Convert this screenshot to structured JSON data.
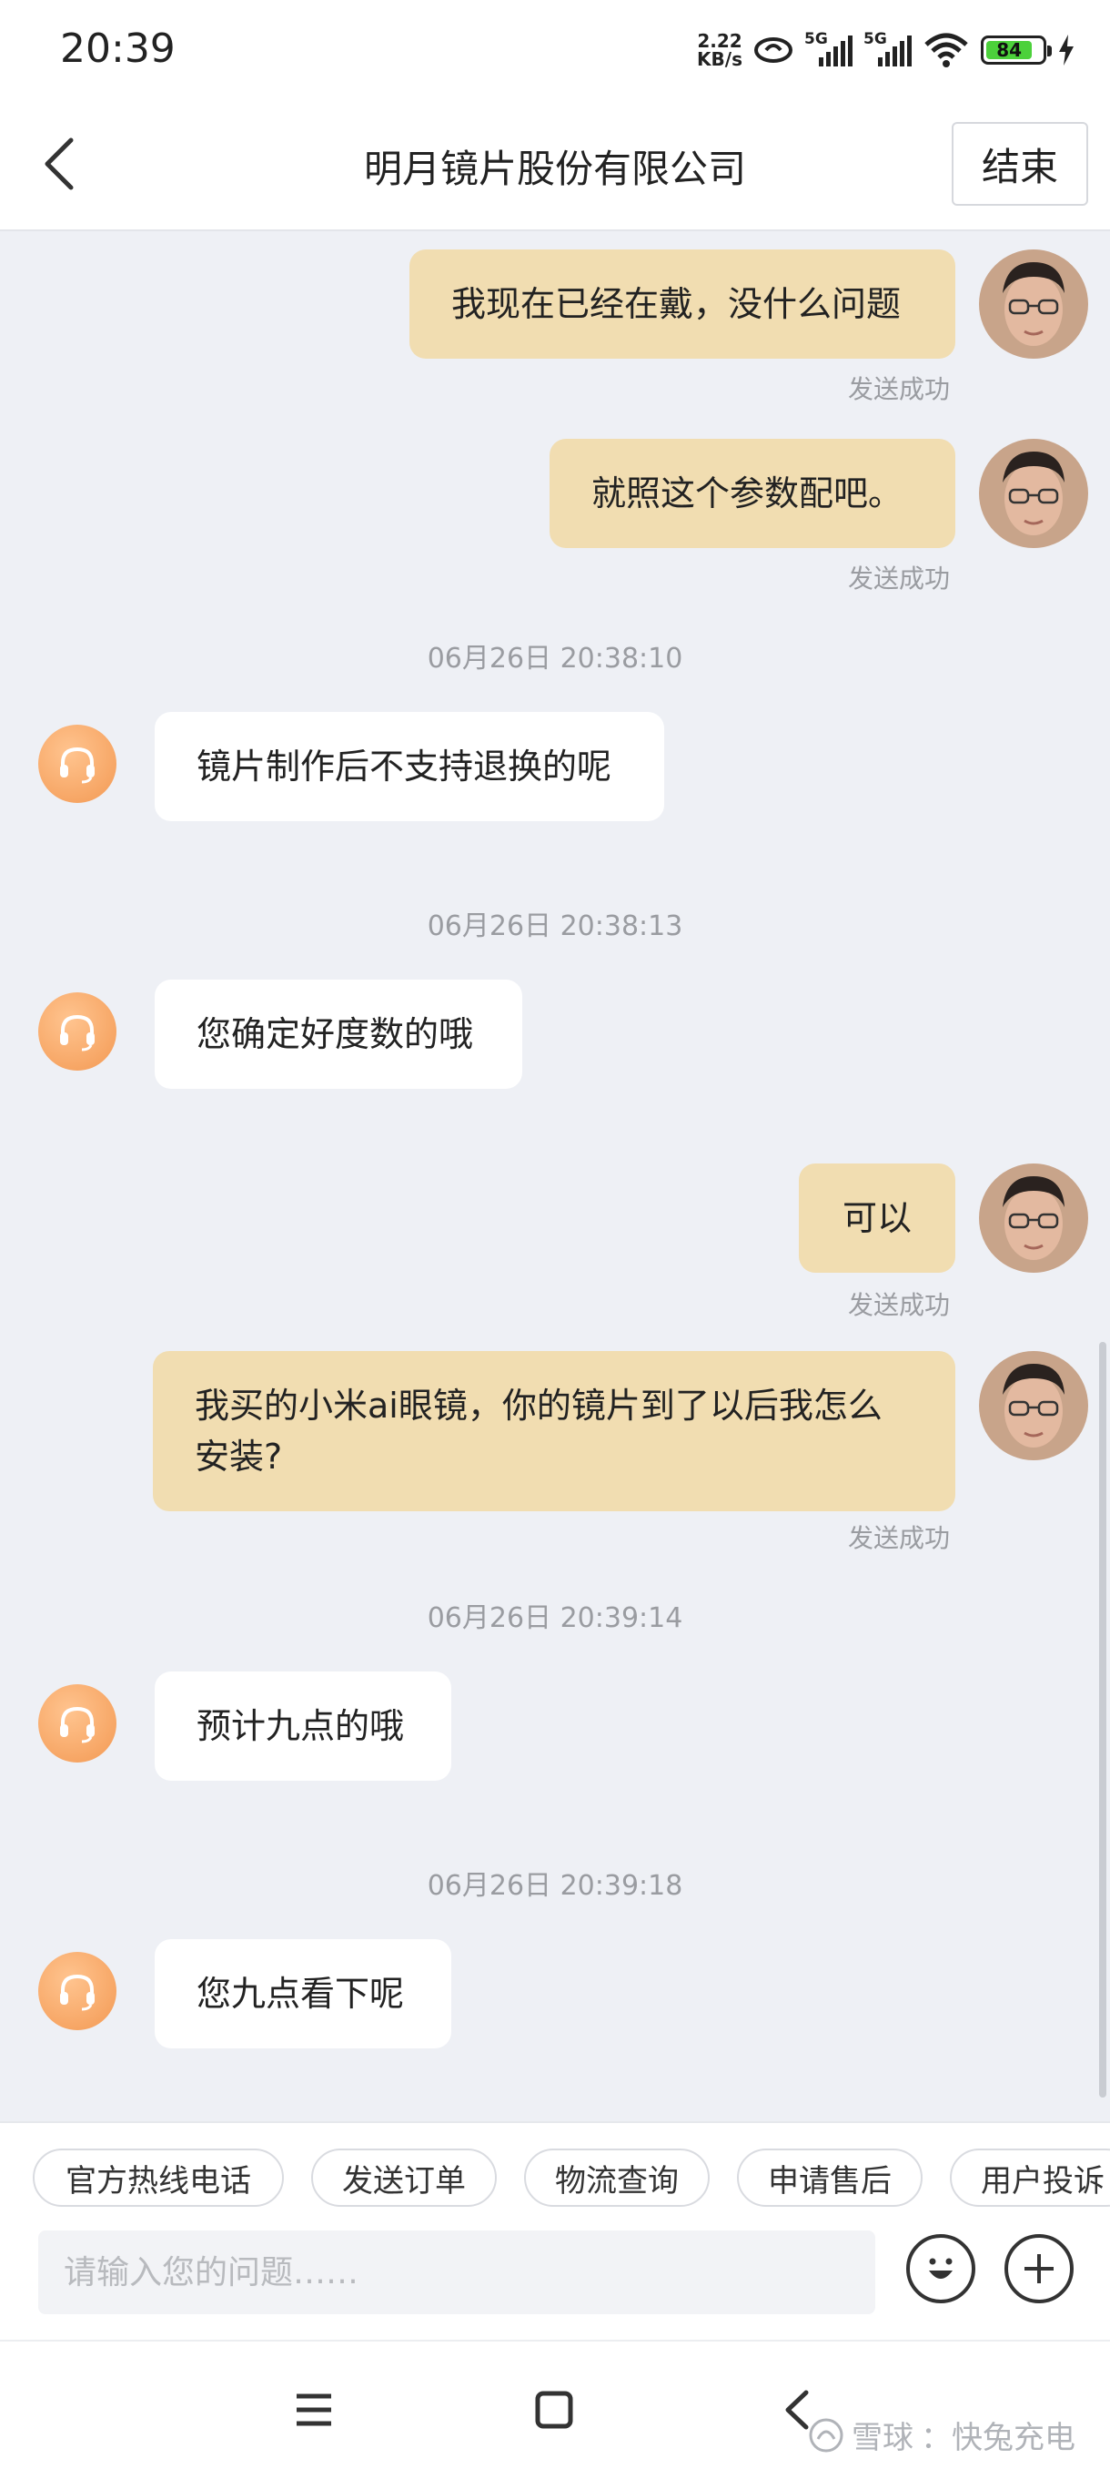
{
  "status_bar": {
    "time": "20:39",
    "net_speed_value": "2.22",
    "net_speed_unit": "KB/s",
    "sim1_label": "5G",
    "sim2_label": "5G",
    "battery_level": "84"
  },
  "header": {
    "title": "明月镜片股份有限公司",
    "end_label": "结束"
  },
  "messages": [
    {
      "from": "me",
      "text": "我现在已经在戴，没什么问题",
      "status": "发送成功"
    },
    {
      "from": "me",
      "text": "就照这个参数配吧。",
      "status": "发送成功"
    },
    {
      "type": "timestamp",
      "text": "06月26日 20:38:10"
    },
    {
      "from": "agent",
      "text": "镜片制作后不支持退换的呢"
    },
    {
      "type": "timestamp",
      "text": "06月26日 20:38:13"
    },
    {
      "from": "agent",
      "text": "您确定好度数的哦"
    },
    {
      "from": "me",
      "text": "可以",
      "status": "发送成功"
    },
    {
      "from": "me",
      "text": "我买的小米ai眼镜，你的镜片到了以后我怎么安装?",
      "status": "发送成功"
    },
    {
      "type": "timestamp",
      "text": "06月26日 20:39:14"
    },
    {
      "from": "agent",
      "text": "预计九点的哦"
    },
    {
      "type": "timestamp",
      "text": "06月26日 20:39:18"
    },
    {
      "from": "agent",
      "text": "您九点看下呢"
    }
  ],
  "quick_actions": [
    "官方热线电话",
    "发送订单",
    "物流查询",
    "申请售后",
    "用户投诉"
  ],
  "input": {
    "placeholder": "请输入您的问题……"
  },
  "watermark": {
    "brand": "雪球",
    "author": "：快兔充电"
  },
  "colors": {
    "my_bubble": "#f1ddb1",
    "agent_bubble": "#ffffff",
    "chat_background": "#eef0f5",
    "agent_avatar": "#f39953"
  }
}
